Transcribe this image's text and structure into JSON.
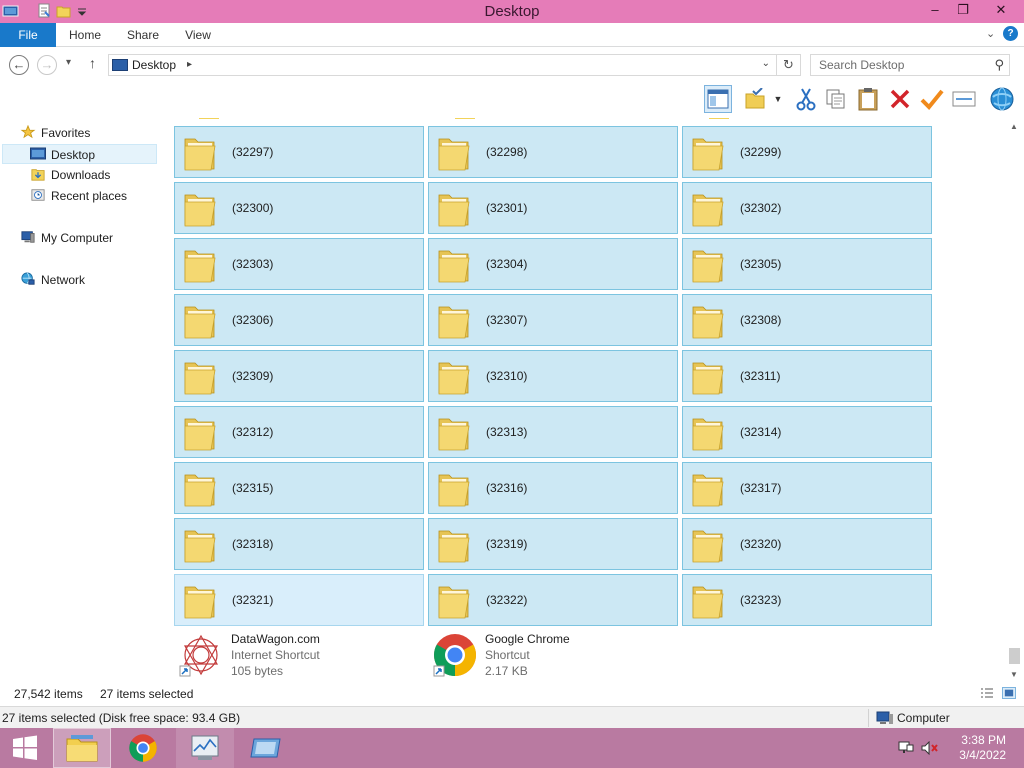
{
  "window": {
    "title": "Desktop",
    "controls": {
      "minimize": "‒",
      "restore": "❐",
      "close": "✕"
    }
  },
  "ribbon": {
    "tabs": [
      "File",
      "Home",
      "Share",
      "View"
    ],
    "collapse_glyph": "⌄",
    "help_glyph": "?"
  },
  "address": {
    "back_glyph": "←",
    "forward_glyph": "→",
    "recent_glyph": "▾",
    "up_glyph": "↑",
    "location": "Desktop",
    "separator_glyph": "▸",
    "dropdown_glyph": "⌄",
    "refresh_glyph": "↻"
  },
  "search": {
    "placeholder": "Search Desktop",
    "icon": "search-icon",
    "glyph": "⚲"
  },
  "toolbar": {
    "buttons": [
      {
        "name": "preview-pane-button",
        "icon": "preview-pane-icon"
      },
      {
        "name": "select-menu-button",
        "icon": "checklist-folder-icon"
      },
      {
        "name": "cut-button",
        "icon": "scissors-icon"
      },
      {
        "name": "copy-button",
        "icon": "copy-icon"
      },
      {
        "name": "paste-button",
        "icon": "clipboard-icon"
      },
      {
        "name": "delete-button",
        "icon": "red-x-icon"
      },
      {
        "name": "checkmark-button",
        "icon": "orange-check-icon"
      },
      {
        "name": "properties-button",
        "icon": "envelope-icon"
      },
      {
        "name": "globe-button",
        "icon": "globe-icon"
      }
    ]
  },
  "sidebar": {
    "items": [
      {
        "label": "Favorites",
        "icon": "star-icon"
      },
      {
        "label": "Desktop",
        "icon": "desktop-icon",
        "selected": true
      },
      {
        "label": "Downloads",
        "icon": "downloads-folder-icon"
      },
      {
        "label": "Recent places",
        "icon": "recent-places-icon"
      },
      {
        "label": "My Computer",
        "icon": "computer-icon"
      },
      {
        "label": "Network",
        "icon": "network-icon"
      }
    ]
  },
  "content": {
    "folders": [
      "(32297)",
      "(32298)",
      "(32299)",
      "(32300)",
      "(32301)",
      "(32302)",
      "(32303)",
      "(32304)",
      "(32305)",
      "(32306)",
      "(32307)",
      "(32308)",
      "(32309)",
      "(32310)",
      "(32311)",
      "(32312)",
      "(32313)",
      "(32314)",
      "(32315)",
      "(32316)",
      "(32317)",
      "(32318)",
      "(32319)",
      "(32320)",
      "(32321)",
      "(32322)",
      "(32323)"
    ],
    "hovered_folder": "(32321)",
    "shortcuts": [
      {
        "name": "DataWagon.com",
        "type": "Internet Shortcut",
        "size": "105 bytes",
        "icon": "datawagon-icon"
      },
      {
        "name": "Google Chrome",
        "type": "Shortcut",
        "size": "2.17 KB",
        "icon": "chrome-icon"
      }
    ]
  },
  "status": {
    "item_count": "27,542 items",
    "selected_count": "27 items selected",
    "detail": "27 items selected (Disk free space: 93.4 GB)",
    "location": "Computer"
  },
  "taskbar": {
    "apps": [
      {
        "name": "start",
        "icon": "windows-logo-icon"
      },
      {
        "name": "file-explorer",
        "icon": "file-explorer-icon",
        "active": true
      },
      {
        "name": "chrome",
        "icon": "chrome-icon"
      },
      {
        "name": "task-manager",
        "icon": "task-manager-icon",
        "open": true
      },
      {
        "name": "remote-desktop",
        "icon": "remote-desktop-icon"
      }
    ],
    "time": "3:38 PM",
    "date": "3/4/2022"
  }
}
